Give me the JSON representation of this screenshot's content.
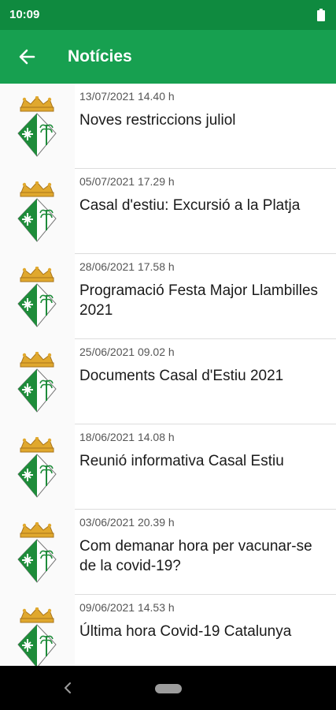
{
  "status_bar": {
    "time": "10:09",
    "battery_icon": "battery-full-icon"
  },
  "app_bar": {
    "title": "Notícies",
    "back_icon": "arrow-back-icon"
  },
  "colors": {
    "status_bar": "#0f8a3f",
    "app_bar": "#17a050",
    "crest_green": "#1e8c3a",
    "crest_gold": "#e0a82e"
  },
  "news": [
    {
      "date": "13/07/2021 14.40 h",
      "title": "Noves restriccions juliol",
      "icon": "municipal-crest-icon"
    },
    {
      "date": "05/07/2021 17.29 h",
      "title": "Casal d'estiu: Excursió a la Platja",
      "icon": "municipal-crest-icon"
    },
    {
      "date": "28/06/2021 17.58 h",
      "title": "Programació Festa Major Llambilles\n2021",
      "icon": "municipal-crest-icon"
    },
    {
      "date": "25/06/2021 09.02 h",
      "title": "Documents Casal d'Estiu 2021",
      "icon": "municipal-crest-icon"
    },
    {
      "date": "18/06/2021 14.08 h",
      "title": "Reunió informativa Casal Estiu",
      "icon": "municipal-crest-icon"
    },
    {
      "date": "03/06/2021 20.39 h",
      "title": "Com demanar hora per vacunar-se\nde la covid-19?",
      "icon": "municipal-crest-icon"
    },
    {
      "date": "09/06/2021 14.53 h",
      "title": "Última hora Covid-19 Catalunya",
      "icon": "municipal-crest-icon"
    }
  ],
  "nav_bar": {
    "back_icon": "nav-back-icon",
    "home_icon": "nav-home-pill-icon"
  }
}
